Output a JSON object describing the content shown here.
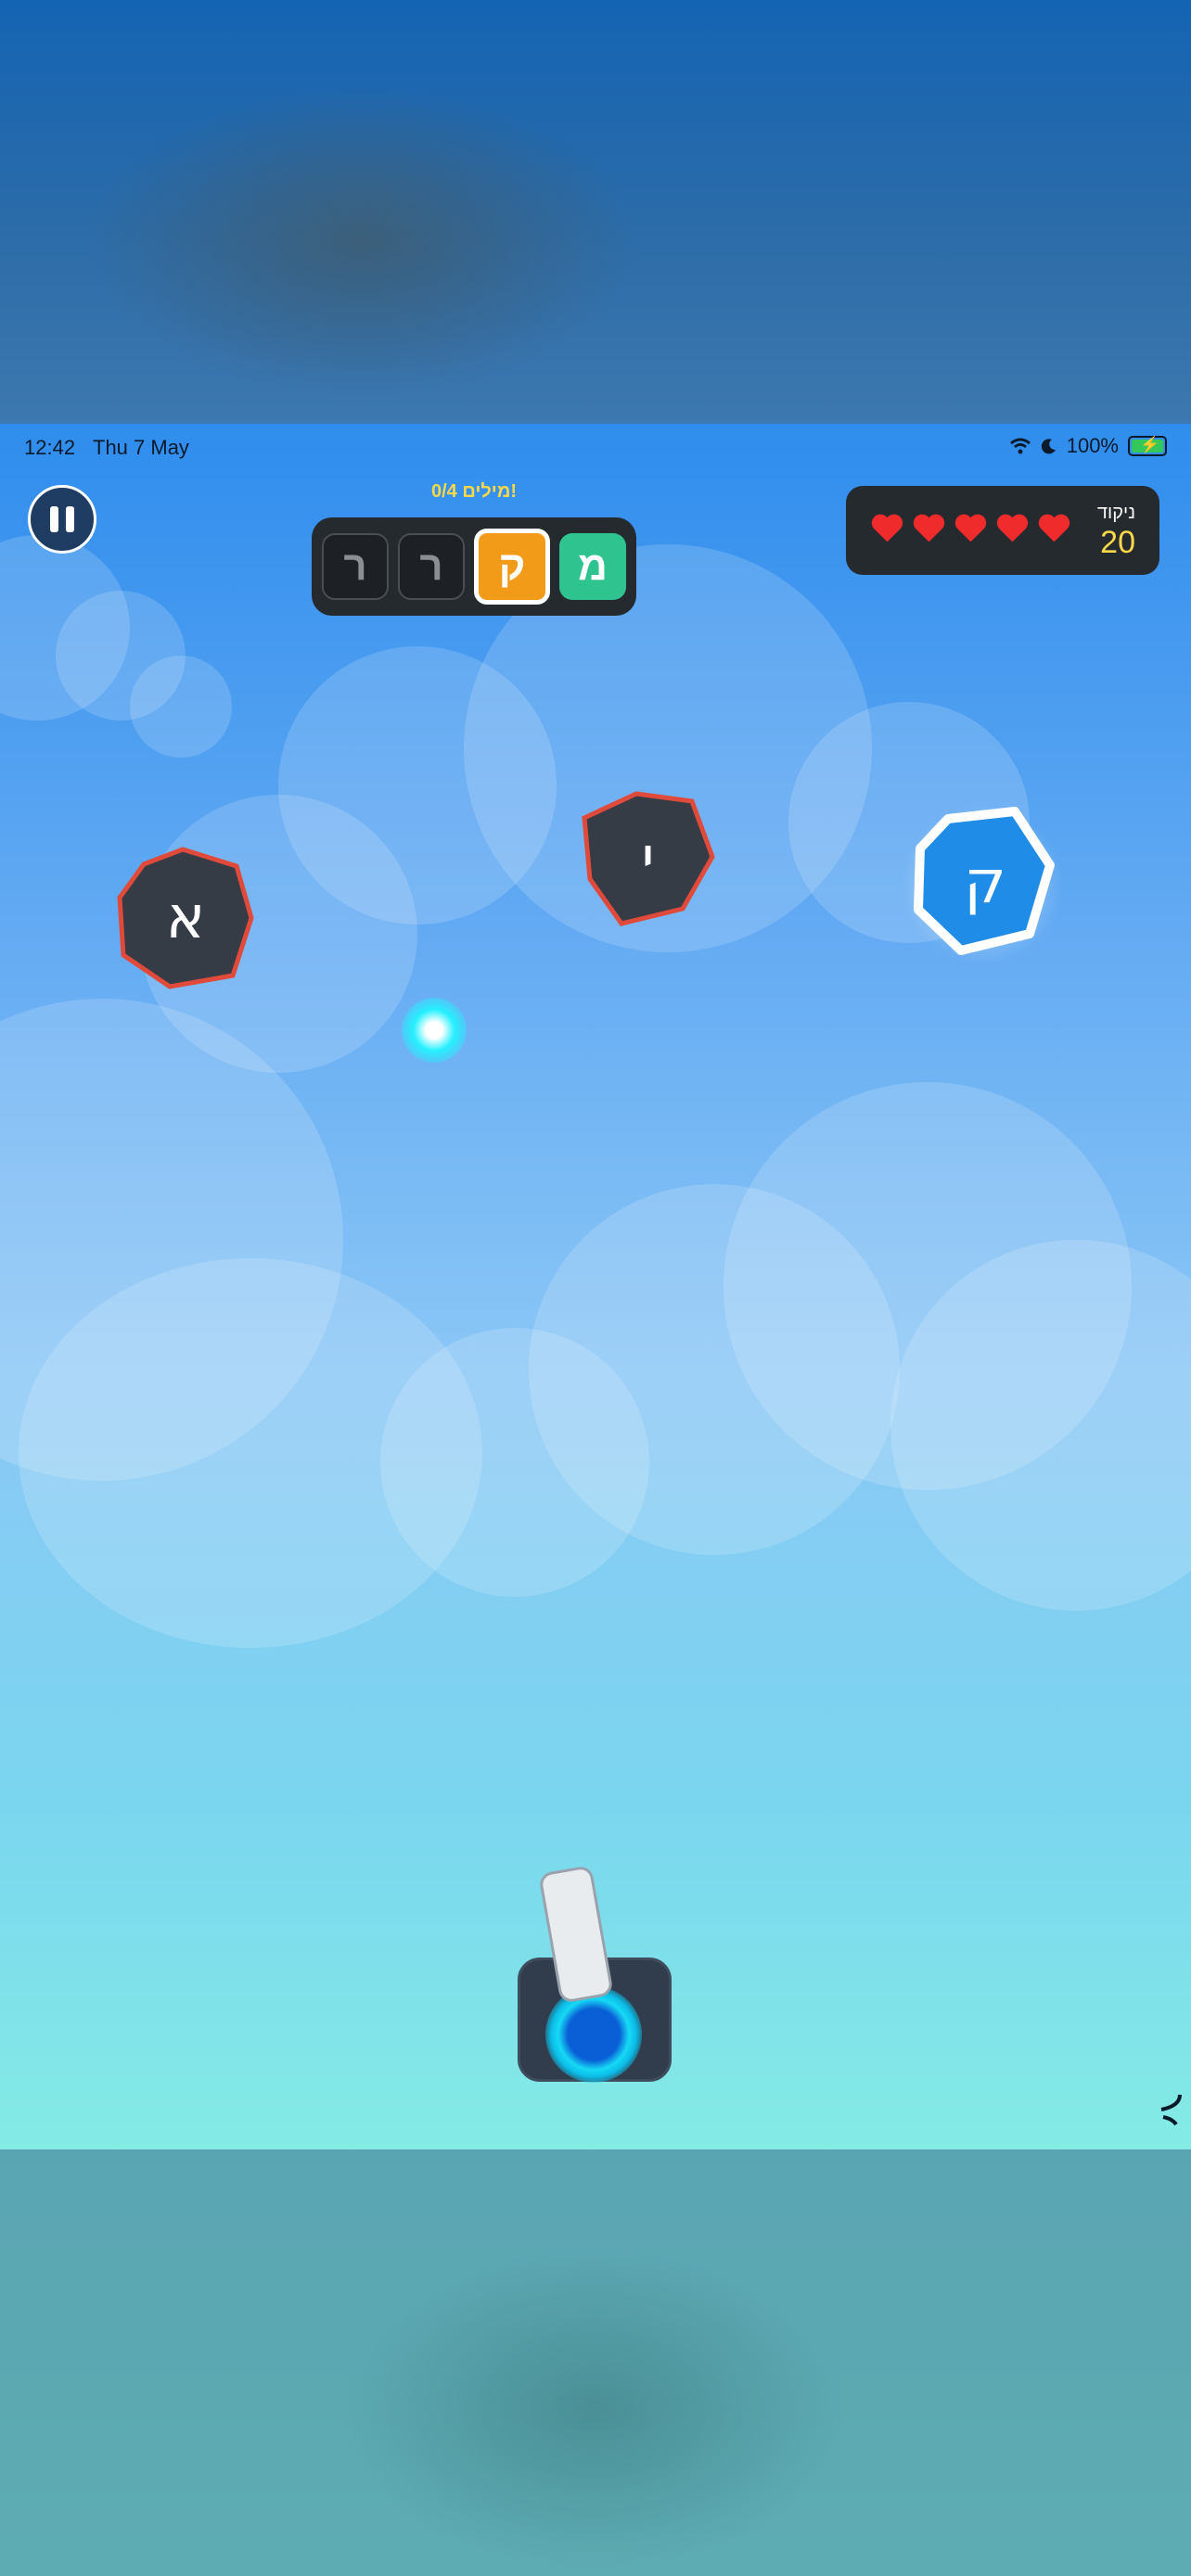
{
  "status_bar": {
    "time": "12:42",
    "date": "Thu 7 May",
    "battery": "100%"
  },
  "hud": {
    "words_progress": "0/4 מילים!",
    "word_tiles": [
      {
        "letter": "ר",
        "state": "pending"
      },
      {
        "letter": "ר",
        "state": "pending"
      },
      {
        "letter": "ק",
        "state": "active"
      },
      {
        "letter": "מ",
        "state": "done"
      }
    ],
    "lives": 5,
    "score_label": "ניקוד",
    "score_value": "20"
  },
  "asteroids": [
    {
      "letter": "א",
      "type": "wrong"
    },
    {
      "letter": "י",
      "type": "wrong"
    },
    {
      "letter": "ק",
      "type": "target"
    }
  ],
  "colors": {
    "tile_active": "#f29b19",
    "tile_done": "#2fc48f",
    "asteroid_wrong_fill": "#353c45",
    "asteroid_wrong_outline": "#e04a3a",
    "asteroid_target_fill": "#1f8de8",
    "heart": "#ef2b2b",
    "score": "#ffd84a",
    "bullet": "#25f0ff"
  },
  "icons": {
    "pause": "pause-icon",
    "heart": "heart-icon",
    "wifi": "wifi-icon",
    "moon": "moon-icon",
    "battery": "battery-icon"
  }
}
